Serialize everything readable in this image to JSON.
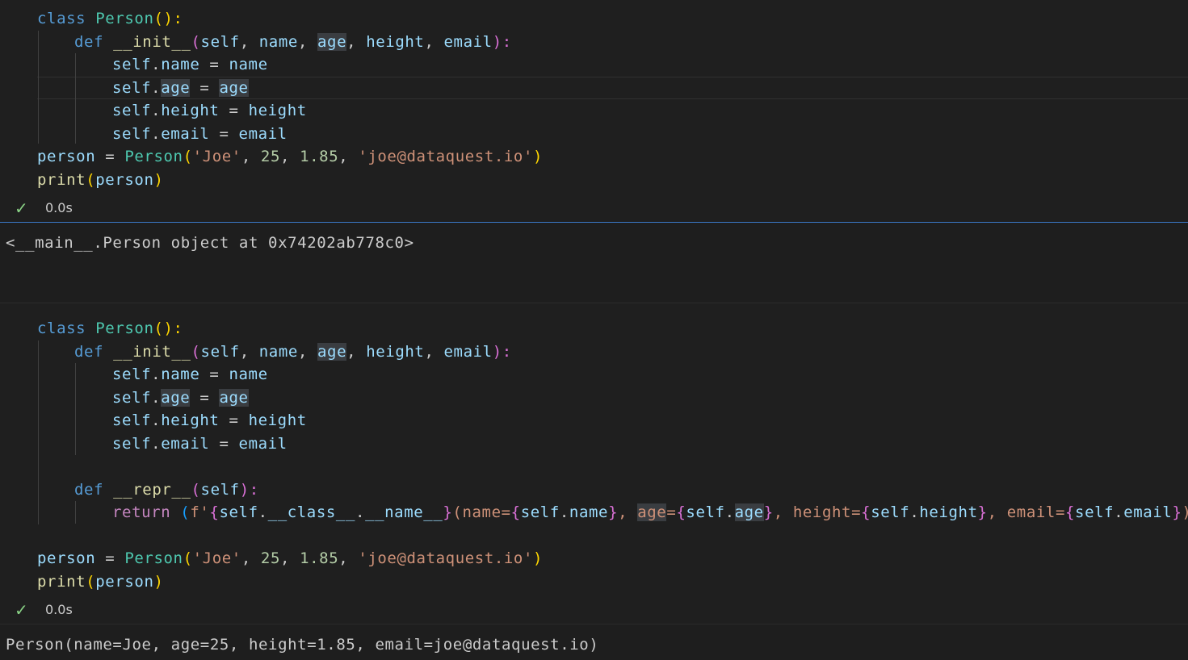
{
  "cell1": {
    "code": {
      "l1": [
        "class",
        " ",
        "Person",
        "():"
      ],
      "l2": [
        "def",
        " ",
        "__init__",
        "(",
        "self",
        ", ",
        "name",
        ", ",
        "age",
        ", ",
        "height",
        ", ",
        "email",
        "):"
      ],
      "l3": [
        "self",
        ".",
        "name",
        " = ",
        "name"
      ],
      "l4": [
        "self",
        ".",
        "age",
        " = ",
        "age"
      ],
      "l5": [
        "self",
        ".",
        "height",
        " = ",
        "height"
      ],
      "l6": [
        "self",
        ".",
        "email",
        " = ",
        "email"
      ],
      "l7": [
        "person",
        " = ",
        "Person",
        "(",
        "'Joe'",
        ", ",
        "25",
        ", ",
        "1.85",
        ", ",
        "'joe@dataquest.io'",
        ")"
      ],
      "l8": [
        "print",
        "(",
        "person",
        ")"
      ]
    },
    "status": {
      "check": "✓",
      "time": "0.0s"
    },
    "output": "<__main__.Person object at 0x74202ab778c0>"
  },
  "cell2": {
    "code": {
      "l1": [
        "class",
        " ",
        "Person",
        "():"
      ],
      "l2": [
        "def",
        " ",
        "__init__",
        "(",
        "self",
        ", ",
        "name",
        ", ",
        "age",
        ", ",
        "height",
        ", ",
        "email",
        "):"
      ],
      "l3": [
        "self",
        ".",
        "name",
        " = ",
        "name"
      ],
      "l4": [
        "self",
        ".",
        "age",
        " = ",
        "age"
      ],
      "l5": [
        "self",
        ".",
        "height",
        " = ",
        "height"
      ],
      "l6": [
        "self",
        ".",
        "email",
        " = ",
        "email"
      ],
      "l8": [
        "def",
        " ",
        "__repr__",
        "(",
        "self",
        "):"
      ],
      "l9": [
        "return",
        " ",
        "(",
        "f'",
        "{",
        "self",
        ".",
        "__class__",
        ".",
        "__name__",
        "}",
        "(name=",
        "{",
        "self",
        ".",
        "name",
        "}",
        ", ",
        "age",
        "=",
        "{",
        "self",
        ".",
        "age",
        "}",
        ", height=",
        "{",
        "self",
        ".",
        "height",
        "}",
        ", email=",
        "{",
        "self",
        ".",
        "email",
        "}",
        ")'",
        ")"
      ],
      "l11": [
        "person",
        " = ",
        "Person",
        "(",
        "'Joe'",
        ", ",
        "25",
        ", ",
        "1.85",
        ", ",
        "'joe@dataquest.io'",
        ")"
      ],
      "l12": [
        "print",
        "(",
        "person",
        ")"
      ]
    },
    "status": {
      "check": "✓",
      "time": "0.0s"
    },
    "output": "Person(name=Joe, age=25, height=1.85, email=joe@dataquest.io)"
  }
}
